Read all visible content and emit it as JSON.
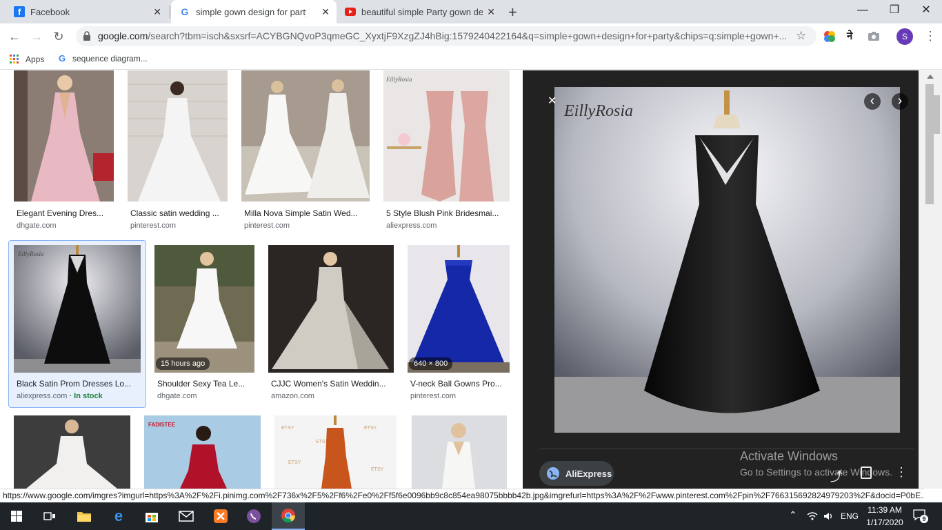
{
  "tabs": [
    {
      "title": "Facebook",
      "close": "✕"
    },
    {
      "title": "simple gown design for party - Google Search",
      "close": "✕"
    },
    {
      "title": "beautiful simple Party gown design - YouTube",
      "close": "✕"
    }
  ],
  "new_tab": "+",
  "window": {
    "minimize": "—",
    "restore": "❐",
    "close": "✕"
  },
  "nav": {
    "back": "←",
    "forward": "→",
    "reload": "↻"
  },
  "omnibox": {
    "host": "google.com",
    "path": "/search?tbm=isch&sxsrf=ACYBGNQvoP3qmeGC_XyxtjF9XzgZJ4hBig:1579240422164&q=simple+gown+design+for+party&chips=q:simple+gown+..."
  },
  "profile_initial": "S",
  "translate_glyph": "ने",
  "bookmarks": [
    {
      "label": "Apps"
    },
    {
      "label": "sequence diagram..."
    }
  ],
  "results": {
    "row1": [
      {
        "caption": "Elegant Evening Dres...",
        "source": "dhgate.com"
      },
      {
        "caption": "Classic satin wedding ...",
        "source": "pinterest.com"
      },
      {
        "caption": "Milla Nova Simple Satin Wed...",
        "source": "pinterest.com"
      },
      {
        "caption": "5 Style Blush Pink Bridesmai...",
        "source": "aliexpress.com"
      }
    ],
    "row2": [
      {
        "caption": "Black Satin Prom Dresses Lo...",
        "source": "aliexpress.com",
        "stock": "· In stock",
        "watermark": "EillyRosia"
      },
      {
        "caption": "Shoulder Sexy Tea Le...",
        "source": "dhgate.com",
        "badge": "15 hours ago"
      },
      {
        "caption": "CJJC Women's Satin Weddin...",
        "source": "amazon.com"
      },
      {
        "caption": "V-neck Ball Gowns Pro...",
        "source": "pinterest.com",
        "badge": "640 × 800"
      }
    ],
    "row3": [
      {
        "caption": ""
      },
      {
        "caption": "",
        "brand": "FADISTEE"
      },
      {
        "caption": ""
      },
      {
        "caption": ""
      }
    ]
  },
  "preview": {
    "watermark": "EillyRosia",
    "close": "✕",
    "prev": "‹",
    "next": "›",
    "source_label": "AliExpress",
    "activate_title": "Activate Windows",
    "activate_sub": "Go to Settings to activate Windows."
  },
  "status_url": "https://www.google.com/imgres?imgurl=https%3A%2F%2Fi.pinimg.com%2F736x%2F5%2Ff6%2Fe0%2Ff5f6e0096bb9c8c854ea98075bbbb42b.jpg&imgrefurl=https%3A%2F%2Fwww.pinterest.com%2Fpin%2F766315692824979203%2F&docid=P0bE...",
  "taskbar": {
    "language": "ENG",
    "time": "11:39 AM",
    "date": "1/17/2020",
    "notifications": "9"
  },
  "colors": {
    "accent": "#1a73e8",
    "in_stock": "#188038",
    "profile": "#673ab7",
    "taskbar": "#1f2428",
    "preview_bg": "#222222"
  }
}
